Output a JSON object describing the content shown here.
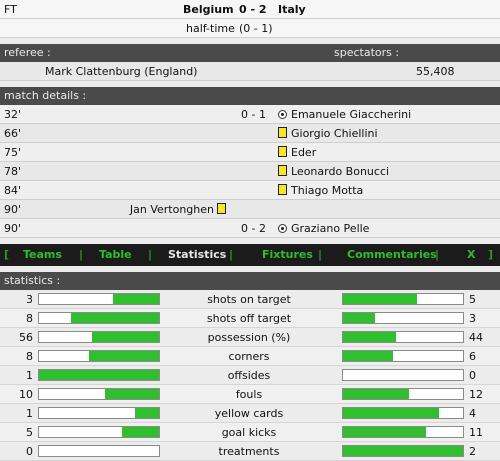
{
  "header": {
    "status": "FT",
    "home_team": "Belgium",
    "score": "0 - 2",
    "away_team": "Italy",
    "halftime_label": "half-time",
    "halftime_score": "(0 - 1)"
  },
  "info": {
    "referee_label": "referee :",
    "spectators_label": "spectators :",
    "referee": "Mark Clattenburg (England)",
    "spectators": "55,408"
  },
  "details": {
    "label": "match details :",
    "events": [
      {
        "minute": "32'",
        "home_player": "",
        "score": "0 - 1",
        "icon": "goal",
        "side": "away",
        "away_player": "Emanuele Giaccherini"
      },
      {
        "minute": "66'",
        "home_player": "",
        "score": "",
        "icon": "yellow-card",
        "side": "away",
        "away_player": "Giorgio Chiellini"
      },
      {
        "minute": "75'",
        "home_player": "",
        "score": "",
        "icon": "yellow-card",
        "side": "away",
        "away_player": "Eder"
      },
      {
        "minute": "78'",
        "home_player": "",
        "score": "",
        "icon": "yellow-card",
        "side": "away",
        "away_player": "Leonardo Bonucci"
      },
      {
        "minute": "84'",
        "home_player": "",
        "score": "",
        "icon": "yellow-card",
        "side": "away",
        "away_player": "Thiago Motta"
      },
      {
        "minute": "90'",
        "home_player": "Jan Vertonghen",
        "score": "",
        "icon": "yellow-card",
        "side": "home",
        "away_player": ""
      },
      {
        "minute": "90'",
        "home_player": "",
        "score": "0 - 2",
        "icon": "goal",
        "side": "away",
        "away_player": "Graziano Pelle"
      }
    ]
  },
  "nav": {
    "items": [
      "Teams",
      "Table",
      "Statistics",
      "Fixtures",
      "Commentaries",
      "X"
    ],
    "separators": [
      "[",
      "|",
      "|",
      "|",
      "|",
      "|",
      "]"
    ],
    "active": "Statistics",
    "colors": {
      "link": "#2ebd2e",
      "active": "#e6e6e6"
    }
  },
  "stats": {
    "label": "statistics :",
    "rows": [
      {
        "name": "shots on target",
        "home": "3",
        "away": "5",
        "home_fill": 0.38,
        "away_fill": 0.62
      },
      {
        "name": "shots off target",
        "home": "8",
        "away": "3",
        "home_fill": 0.73,
        "away_fill": 0.27
      },
      {
        "name": "possession (%)",
        "home": "56",
        "away": "44",
        "home_fill": 0.56,
        "away_fill": 0.44
      },
      {
        "name": "corners",
        "home": "8",
        "away": "6",
        "home_fill": 0.58,
        "away_fill": 0.42
      },
      {
        "name": "offsides",
        "home": "1",
        "away": "0",
        "home_fill": 1.0,
        "away_fill": 0.0
      },
      {
        "name": "fouls",
        "home": "10",
        "away": "12",
        "home_fill": 0.45,
        "away_fill": 0.55
      },
      {
        "name": "yellow cards",
        "home": "1",
        "away": "4",
        "home_fill": 0.2,
        "away_fill": 0.8
      },
      {
        "name": "goal kicks",
        "home": "5",
        "away": "11",
        "home_fill": 0.31,
        "away_fill": 0.69
      },
      {
        "name": "treatments",
        "home": "0",
        "away": "2",
        "home_fill": 0.0,
        "away_fill": 1.0
      }
    ]
  }
}
